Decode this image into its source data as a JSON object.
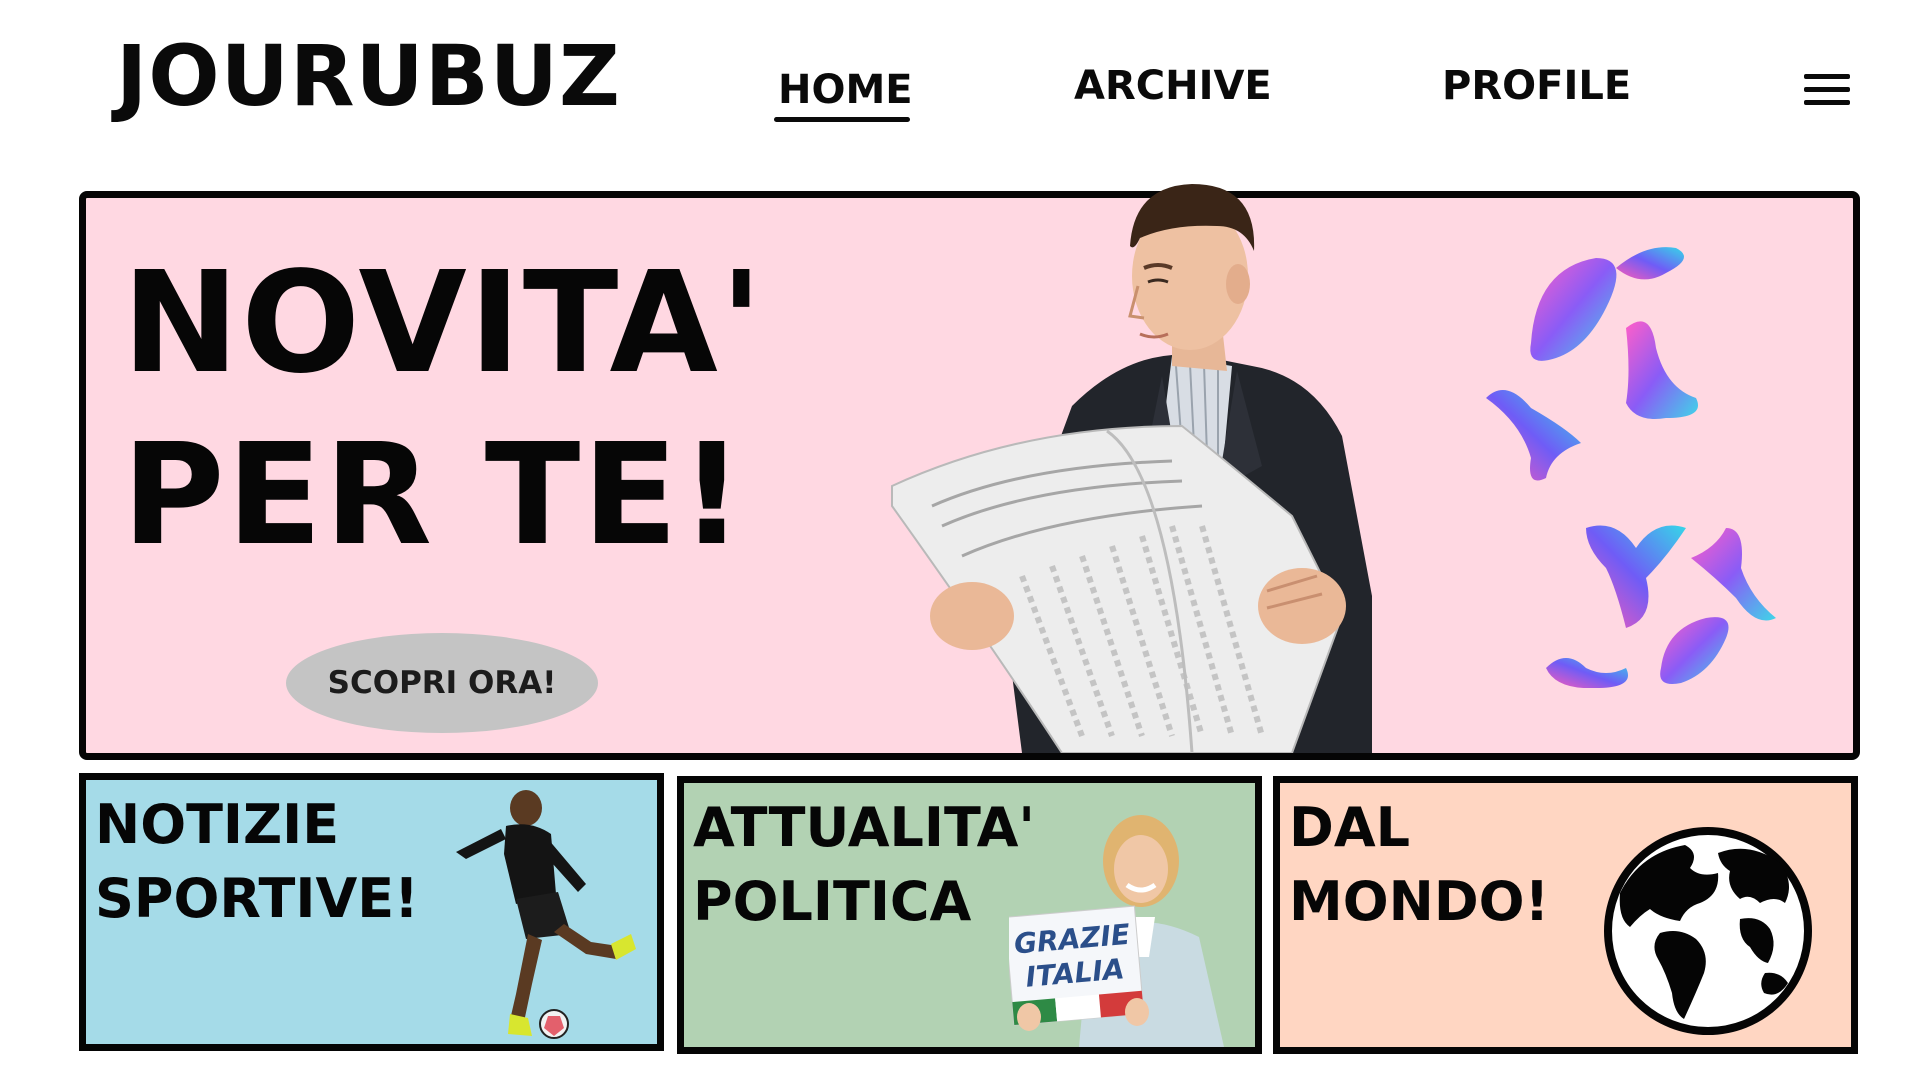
{
  "header": {
    "logo": "JOURUBUZ",
    "nav": {
      "home": "HOME",
      "archive": "ARCHIVE",
      "profile": "PROFILE"
    },
    "active": "HOME"
  },
  "hero": {
    "title_line1": "NOVITA'",
    "title_line2": "PER TE!",
    "cta_label": "SCOPRI ORA!",
    "background_color": "#ffd8e2"
  },
  "cards": [
    {
      "title": "NOTIZIE\nSPORTIVE!",
      "background_color": "#a5dbe8",
      "image": "football-player"
    },
    {
      "title": "ATTUALITA'\nPOLITICA",
      "background_color": "#b2d2b3",
      "image": "politician-holding-sign",
      "sign_line1": "GRAZIE",
      "sign_line2": "ITALIA"
    },
    {
      "title": "DAL\nMONDO!",
      "background_color": "#ffd6c2",
      "image": "globe-icon"
    }
  ],
  "icons": {
    "menu": "hamburger-menu-icon"
  }
}
